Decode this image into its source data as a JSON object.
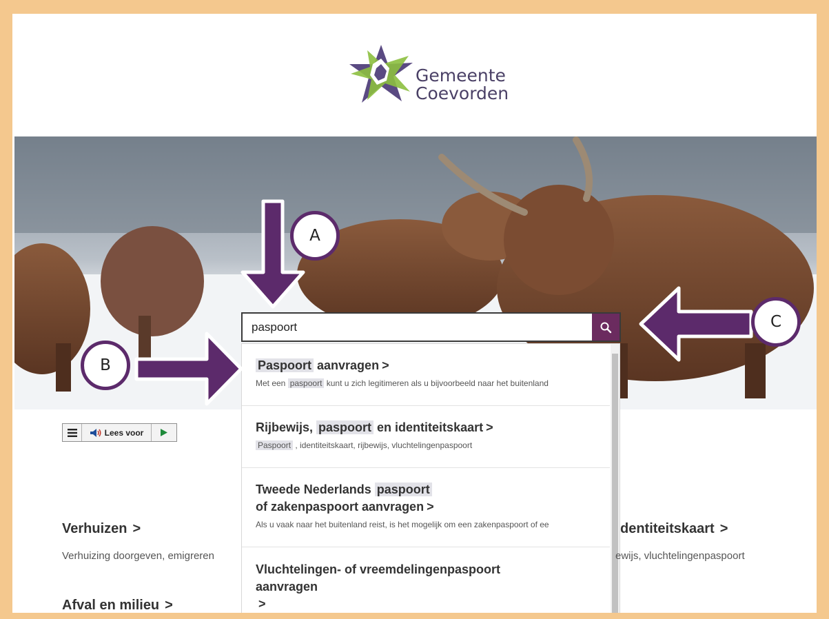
{
  "brand": {
    "line1": "Gemeente",
    "line2": "Coevorden"
  },
  "search": {
    "value": "paspoort"
  },
  "suggestions": [
    {
      "pre": "",
      "hl": "Paspoort",
      "post": " aanvragen",
      "desc_pre": "Met een ",
      "desc_hl": "paspoort",
      "desc_post": " kunt u zich legitimeren als u bijvoorbeeld naar het buitenland"
    },
    {
      "pre": "Rijbewijs, ",
      "hl": "paspoort",
      "post": " en identiteitskaart",
      "desc_pre": "",
      "desc_hl": "Paspoort",
      "desc_post": " , identiteitskaart, rijbewijs, vluchtelingenpaspoort"
    },
    {
      "pre": "Tweede Nederlands ",
      "hl": "paspoort",
      "line2": "of zakenpaspoort aanvragen",
      "desc": "Als u vaak naar het buitenland reist, is het mogelijk om een zakenpaspoort of ee"
    },
    {
      "line1": "Vluchtelingen- of vreemdelingenpaspoort",
      "line2": "aanvragen"
    }
  ],
  "chevron": ">",
  "readbar": {
    "label": "Lees voor"
  },
  "sections": {
    "verhuizen": {
      "title": "Verhuizen",
      "desc": "Verhuizing doorgeven, emigreren"
    },
    "afval": {
      "title": "Afval en milieu"
    },
    "identiteit": {
      "title": "dentiteitskaart",
      "desc": "ewijs, vluchtelingenpaspoort"
    }
  },
  "annotations": {
    "a": "A",
    "b": "B",
    "c": "C"
  },
  "colors": {
    "accent": "#6b2b5f",
    "annotation": "#5c2a6b",
    "frame": "#f4c88e"
  },
  "icons": {
    "search": "search-icon",
    "menu": "menu-icon",
    "speaker": "speaker-icon",
    "play": "play-icon",
    "logo": "logo-star-icon"
  }
}
